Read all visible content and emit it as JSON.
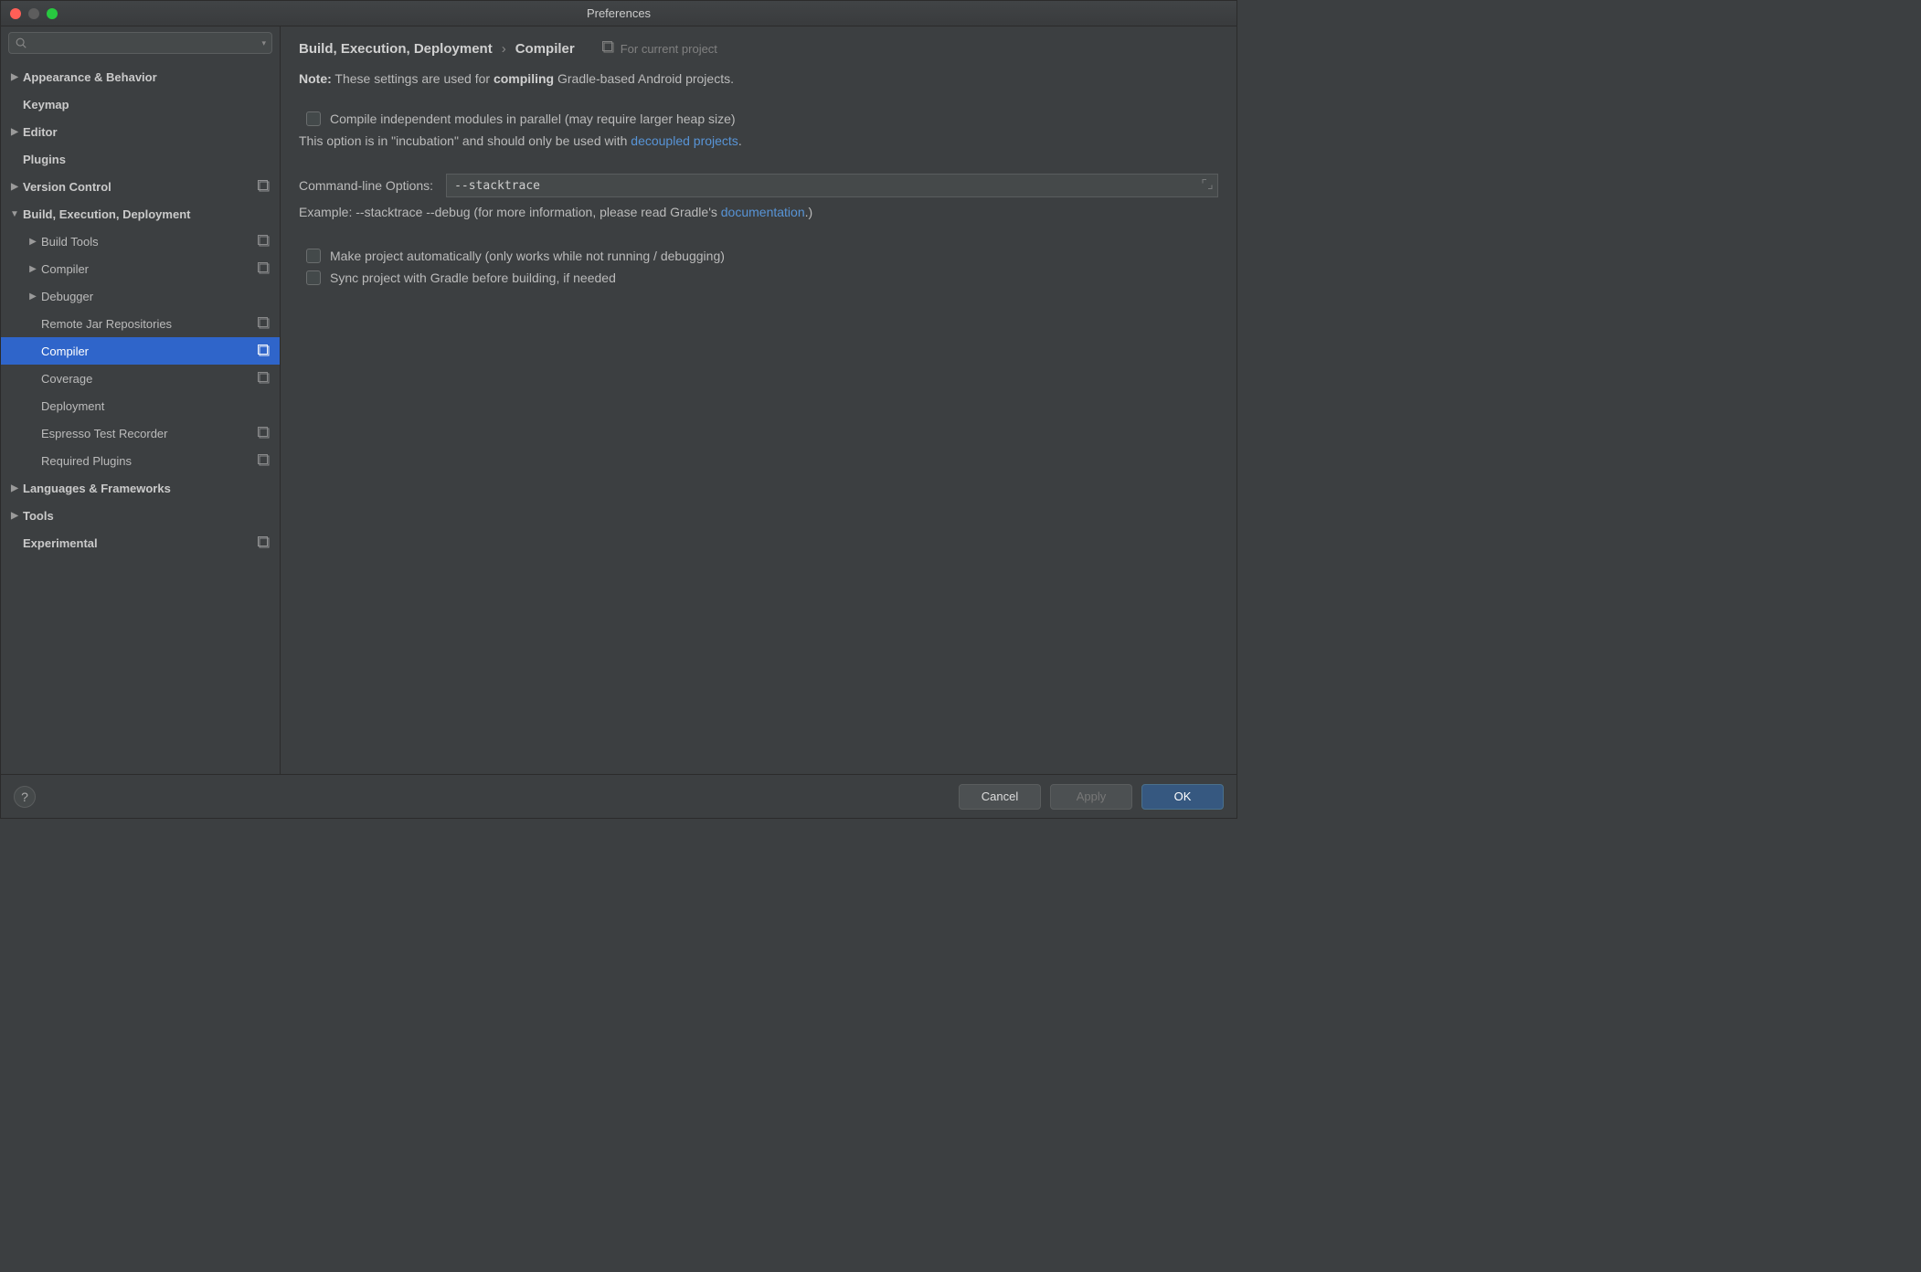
{
  "window": {
    "title": "Preferences"
  },
  "search": {
    "placeholder": ""
  },
  "sidebar": {
    "items": [
      {
        "label": "Appearance & Behavior",
        "level": 0,
        "arrow": "right",
        "bold": true,
        "scope": false
      },
      {
        "label": "Keymap",
        "level": 0,
        "arrow": "",
        "bold": true,
        "scope": false
      },
      {
        "label": "Editor",
        "level": 0,
        "arrow": "right",
        "bold": true,
        "scope": false
      },
      {
        "label": "Plugins",
        "level": 0,
        "arrow": "",
        "bold": true,
        "scope": false
      },
      {
        "label": "Version Control",
        "level": 0,
        "arrow": "right",
        "bold": true,
        "scope": true
      },
      {
        "label": "Build, Execution, Deployment",
        "level": 0,
        "arrow": "down",
        "bold": true,
        "scope": false
      },
      {
        "label": "Build Tools",
        "level": 1,
        "arrow": "right",
        "bold": false,
        "scope": true
      },
      {
        "label": "Compiler",
        "level": 1,
        "arrow": "right",
        "bold": false,
        "scope": true
      },
      {
        "label": "Debugger",
        "level": 1,
        "arrow": "right",
        "bold": false,
        "scope": false
      },
      {
        "label": "Remote Jar Repositories",
        "level": 1,
        "arrow": "",
        "bold": false,
        "scope": true
      },
      {
        "label": "Compiler",
        "level": 1,
        "arrow": "",
        "bold": false,
        "scope": true,
        "selected": true
      },
      {
        "label": "Coverage",
        "level": 1,
        "arrow": "",
        "bold": false,
        "scope": true
      },
      {
        "label": "Deployment",
        "level": 1,
        "arrow": "",
        "bold": false,
        "scope": false
      },
      {
        "label": "Espresso Test Recorder",
        "level": 1,
        "arrow": "",
        "bold": false,
        "scope": true
      },
      {
        "label": "Required Plugins",
        "level": 1,
        "arrow": "",
        "bold": false,
        "scope": true
      },
      {
        "label": "Languages & Frameworks",
        "level": 0,
        "arrow": "right",
        "bold": true,
        "scope": false
      },
      {
        "label": "Tools",
        "level": 0,
        "arrow": "right",
        "bold": true,
        "scope": false
      },
      {
        "label": "Experimental",
        "level": 0,
        "arrow": "",
        "bold": true,
        "scope": true
      }
    ]
  },
  "breadcrumb": {
    "parent": "Build, Execution, Deployment",
    "sep": "›",
    "current": "Compiler",
    "scope_note": "For current project"
  },
  "main": {
    "note_label": "Note:",
    "note_prefix": " These settings are used for ",
    "note_strong": "compiling",
    "note_suffix": " Gradle-based Android projects.",
    "check_parallel": "Compile independent modules in parallel (may require larger heap size)",
    "incubation_prefix": "This option is in \"incubation\" and should only be used with ",
    "incubation_link": "decoupled projects",
    "incubation_suffix": ".",
    "cmd_label": "Command-line Options:",
    "cmd_value": "--stacktrace",
    "example_prefix": "Example: --stacktrace --debug (for more information, please read Gradle's ",
    "example_link": "documentation",
    "example_suffix": ".)",
    "check_make": "Make project automatically (only works while not running / debugging)",
    "check_sync": "Sync project with Gradle before building, if needed"
  },
  "footer": {
    "help": "?",
    "cancel": "Cancel",
    "apply": "Apply",
    "ok": "OK"
  }
}
